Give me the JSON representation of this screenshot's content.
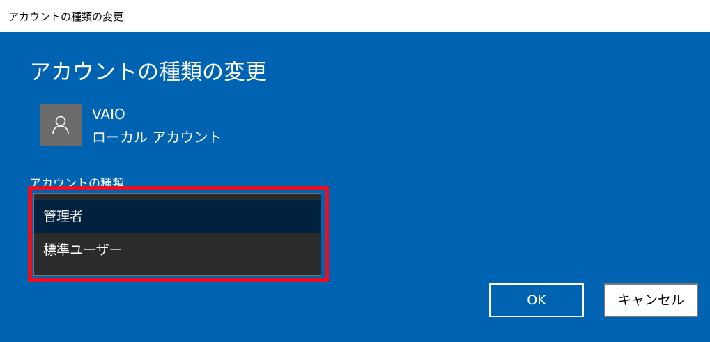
{
  "window": {
    "title": "アカウントの種類の変更"
  },
  "dialog": {
    "heading": "アカウントの種類の変更",
    "user": {
      "name": "VAIO",
      "account_type": "ローカル アカウント",
      "avatar_icon": "person-icon"
    },
    "field_label": "アカウントの種類",
    "dropdown": {
      "options": [
        {
          "label": "管理者",
          "selected": true
        },
        {
          "label": "標準ユーザー",
          "selected": false
        }
      ]
    },
    "buttons": {
      "ok_label": "OK",
      "cancel_label": "キャンセル"
    }
  },
  "colors": {
    "background": "#0063b1",
    "titlebar": "#ffffff",
    "highlight_frame": "#e81123",
    "dropdown_bg": "#2b2b2b",
    "selected_option_bg": "#00223f",
    "avatar_bg": "#6b6b6b"
  }
}
